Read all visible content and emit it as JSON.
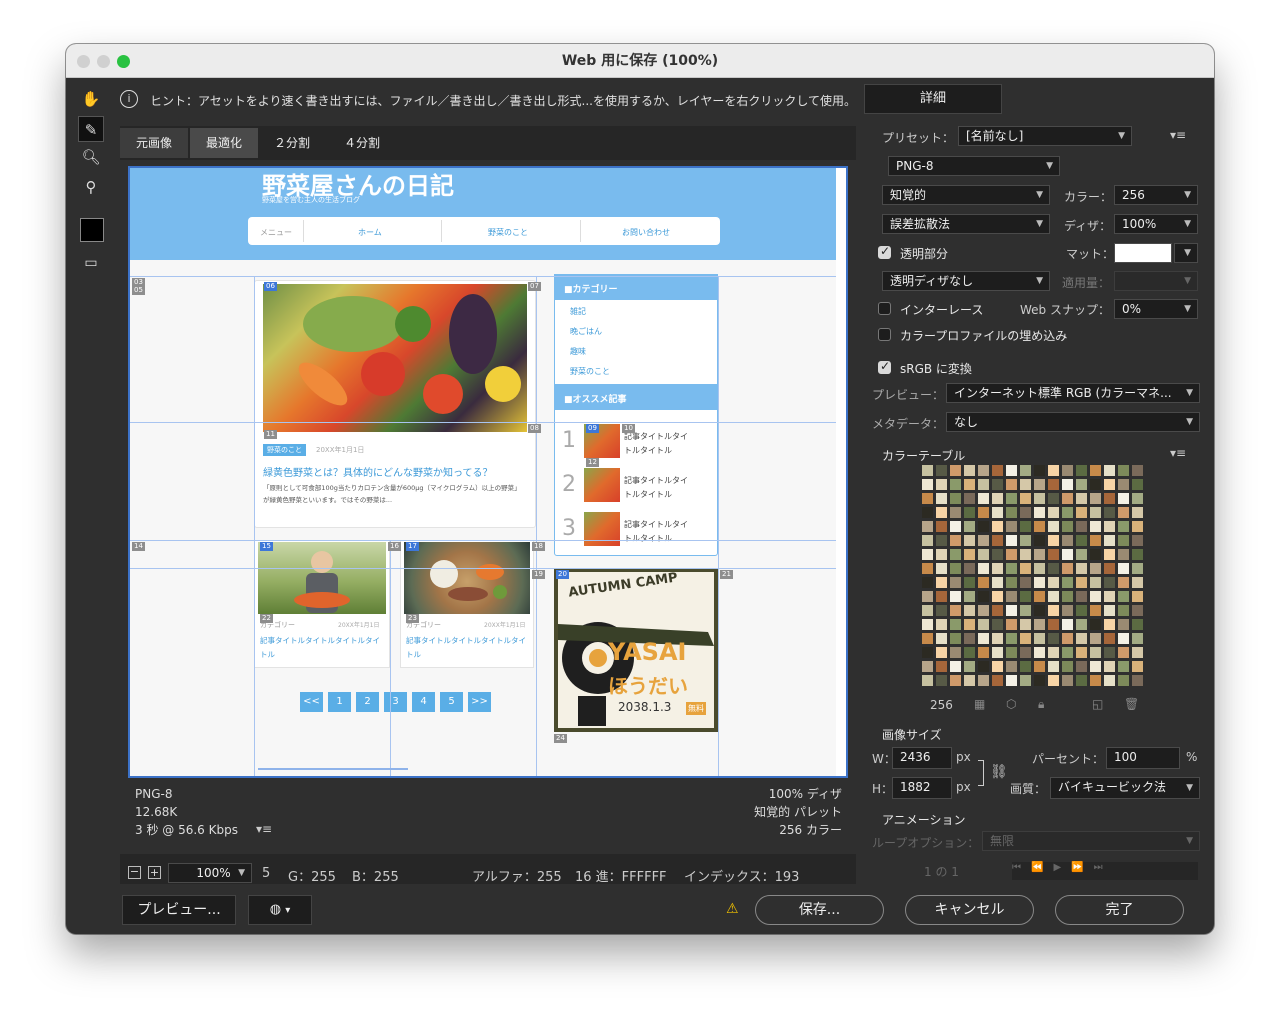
{
  "window": {
    "title": "Web 用に保存 (100%)"
  },
  "hint": {
    "text": "ヒント：アセットをより速く書き出すには、ファイル／書き出し／書き出し形式...を使用するか、レイヤーを右クリックして使用。"
  },
  "detail_button": "詳細",
  "tabs": [
    "元画像",
    "最適化",
    "２分割",
    "４分割"
  ],
  "site": {
    "title": "野菜屋さんの日記",
    "subtitle": "野菜屋を営む主人の生活ブログ",
    "nav": [
      "メニュー",
      "ホーム",
      "野菜のこと",
      "お問い合わせ"
    ],
    "article": {
      "tag": "野菜のこと",
      "date": "20XX年1月1日",
      "title": "緑黄色野菜とは？具体的にどんな野菜か知ってる？",
      "body": "「原則として可食部100g当たりカロテン含量が600μg（マイクログラム）以上の野菜」が緑黄色野菜といいます。ではその野菜は..."
    },
    "sidebar": {
      "category_head": "■カテゴリー",
      "categories": [
        "雑記",
        "晩ごはん",
        "趣味",
        "野菜のこと"
      ],
      "recommend_head": "■オススメ記事",
      "recommend": [
        {
          "rank": "1",
          "title": "記事タイトルタイトルタイトル"
        },
        {
          "rank": "2",
          "title": "記事タイトルタイトルタイトル"
        },
        {
          "rank": "3",
          "title": "記事タイトルタイトルタイトル"
        }
      ]
    },
    "cards": [
      {
        "cat": "カテゴリー",
        "date": "20XX年1月1日",
        "title": "記事タイトルタイトルタイトルタイトル"
      },
      {
        "cat": "カテゴリー",
        "date": "20XX年1月1日",
        "title": "記事タイトルタイトルタイトルタイトル"
      }
    ],
    "pagination": [
      "<<",
      "1",
      "2",
      "3",
      "4",
      "5",
      ">>"
    ],
    "banner": {
      "top": "AUTUMN CAMP",
      "main": "YASAI",
      "sub": "ほうだい",
      "date": "2038.1.3",
      "badge": "無料"
    },
    "slices": [
      "03",
      "05",
      "06",
      "07",
      "08",
      "09",
      "10",
      "11",
      "12",
      "14",
      "15",
      "16",
      "17",
      "18",
      "19",
      "20",
      "21",
      "22",
      "23",
      "24"
    ]
  },
  "preview_info": {
    "format": "PNG-8",
    "size": "12.68K",
    "speed": "3 秒 @ 56.6 Kbps",
    "dither": "100% ディザ",
    "palette": "知覚的 パレット",
    "colors": "256 カラー"
  },
  "statusbar": {
    "zoom": "100%",
    "r": "5",
    "g": "G：255",
    "b": "B：255",
    "alpha": "アルファ：255",
    "hex": "16 進：FFFFFF",
    "index": "インデックス：193"
  },
  "settings": {
    "preset_label": "プリセット：",
    "preset": "[名前なし]",
    "format": "PNG-8",
    "reduction": "知覚的",
    "colors_label": "カラー：",
    "colors": "256",
    "dither_algo": "誤差拡散法",
    "dither_label": "ディザ：",
    "dither": "100%",
    "transparency": "透明部分",
    "matte_label": "マット：",
    "trans_dither": "透明ディザなし",
    "amount_label": "適用量：",
    "interlace": "インターレース",
    "websnap_label": "Web スナップ：",
    "websnap": "0%",
    "embed_profile": "カラープロファイルの埋め込み",
    "srgb": "sRGB に変換",
    "preview_label": "プレビュー：",
    "preview": "インターネット標準 RGB (カラーマネ...",
    "metadata_label": "メタデータ：",
    "metadata": "なし",
    "color_table": "カラーテーブル",
    "color_count": "256",
    "image_size": "画像サイズ",
    "w_label": "W：",
    "w": "2436",
    "h_label": "H：",
    "h": "1882",
    "px": "px",
    "percent_label": "パーセント：",
    "percent": "100",
    "percent_unit": "%",
    "quality_label": "画質：",
    "quality": "バイキュービック法",
    "animation": "アニメーション",
    "loop_label": "ループオプション：",
    "loop": "無限",
    "frame": "1 の 1"
  },
  "buttons": {
    "preview": "プレビュー...",
    "save": "保存...",
    "cancel": "キャンセル",
    "done": "完了"
  },
  "colors": {
    "accent": "#3c72c8",
    "site_blue": "#79bbee",
    "site_link": "#3d9ad8"
  }
}
